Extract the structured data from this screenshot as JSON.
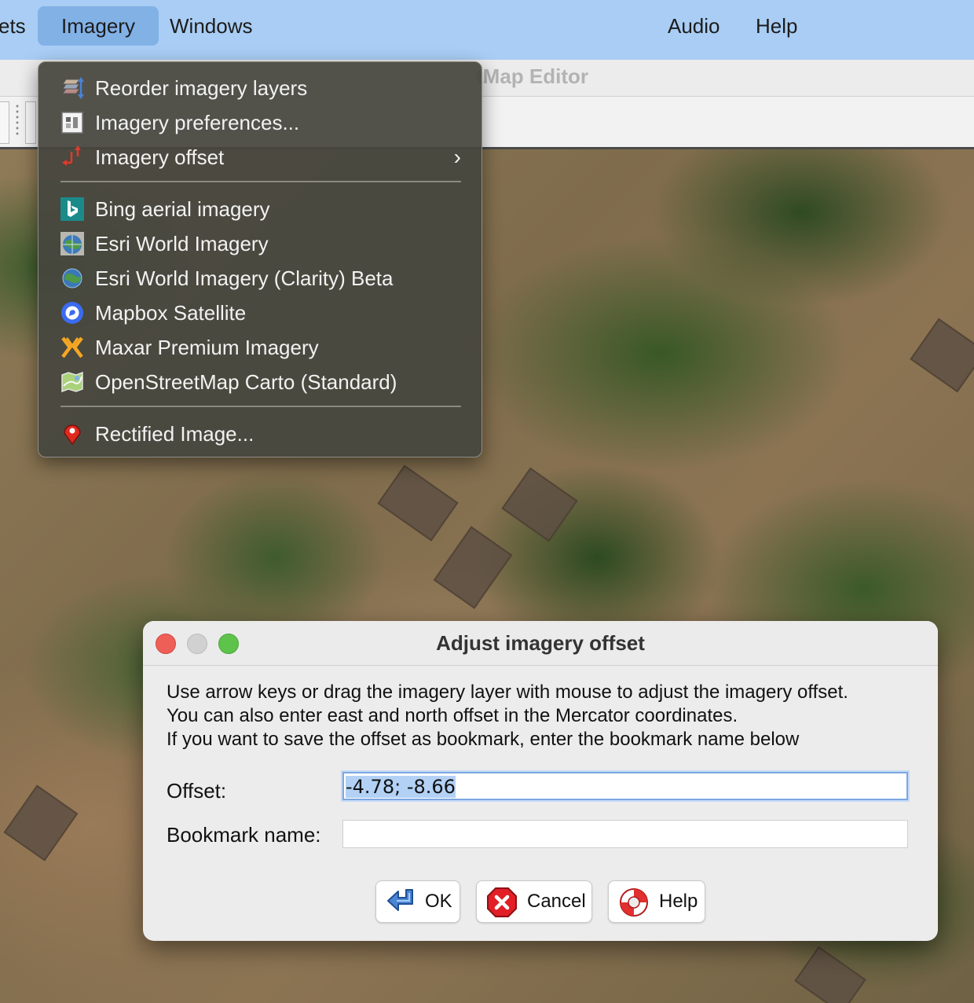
{
  "menubar": {
    "items": [
      "ets",
      "Imagery",
      "Windows",
      "Audio",
      "Help"
    ],
    "active": "Imagery"
  },
  "window": {
    "title_fragment": "tMap Editor"
  },
  "imagery_menu": {
    "group1": [
      {
        "label": "Reorder imagery layers",
        "icon": "reorder-layers-icon"
      },
      {
        "label": "Imagery preferences...",
        "icon": "preferences-icon"
      },
      {
        "label": "Imagery offset",
        "icon": "offset-arrows-icon",
        "submenu": true
      }
    ],
    "group2": [
      {
        "label": "Bing aerial imagery",
        "icon": "bing-logo-icon"
      },
      {
        "label": "Esri World Imagery",
        "icon": "esri-globe-icon"
      },
      {
        "label": "Esri World Imagery (Clarity) Beta",
        "icon": "globe-icon"
      },
      {
        "label": "Mapbox Satellite",
        "icon": "mapbox-logo-icon"
      },
      {
        "label": "Maxar Premium Imagery",
        "icon": "maxar-logo-icon"
      },
      {
        "label": "OpenStreetMap Carto (Standard)",
        "icon": "osm-map-icon"
      }
    ],
    "group3": [
      {
        "label": "Rectified Image...",
        "icon": "map-pin-icon"
      }
    ],
    "submenu_glyph": "›"
  },
  "dialog": {
    "title": "Adjust imagery offset",
    "message": [
      "Use arrow keys or drag the imagery layer with mouse to adjust the imagery offset.",
      "You can also enter east and north offset in the Mercator coordinates.",
      "If you want to save the offset as bookmark, enter the bookmark name below"
    ],
    "offset_label": "Offset:",
    "offset_value": "-4.78; -8.66",
    "bookmark_label": "Bookmark name:",
    "bookmark_value": "",
    "buttons": {
      "ok": "OK",
      "cancel": "Cancel",
      "help": "Help"
    }
  },
  "colors": {
    "menubar_bg": "#a9cdf4",
    "menu_active_bg": "#82b1e6",
    "dropdown_bg": "#46463e",
    "traffic_red": "#ed5f57",
    "traffic_gray": "#d1d1d1",
    "traffic_green": "#5ec34b",
    "selection": "#b2d1f5"
  }
}
